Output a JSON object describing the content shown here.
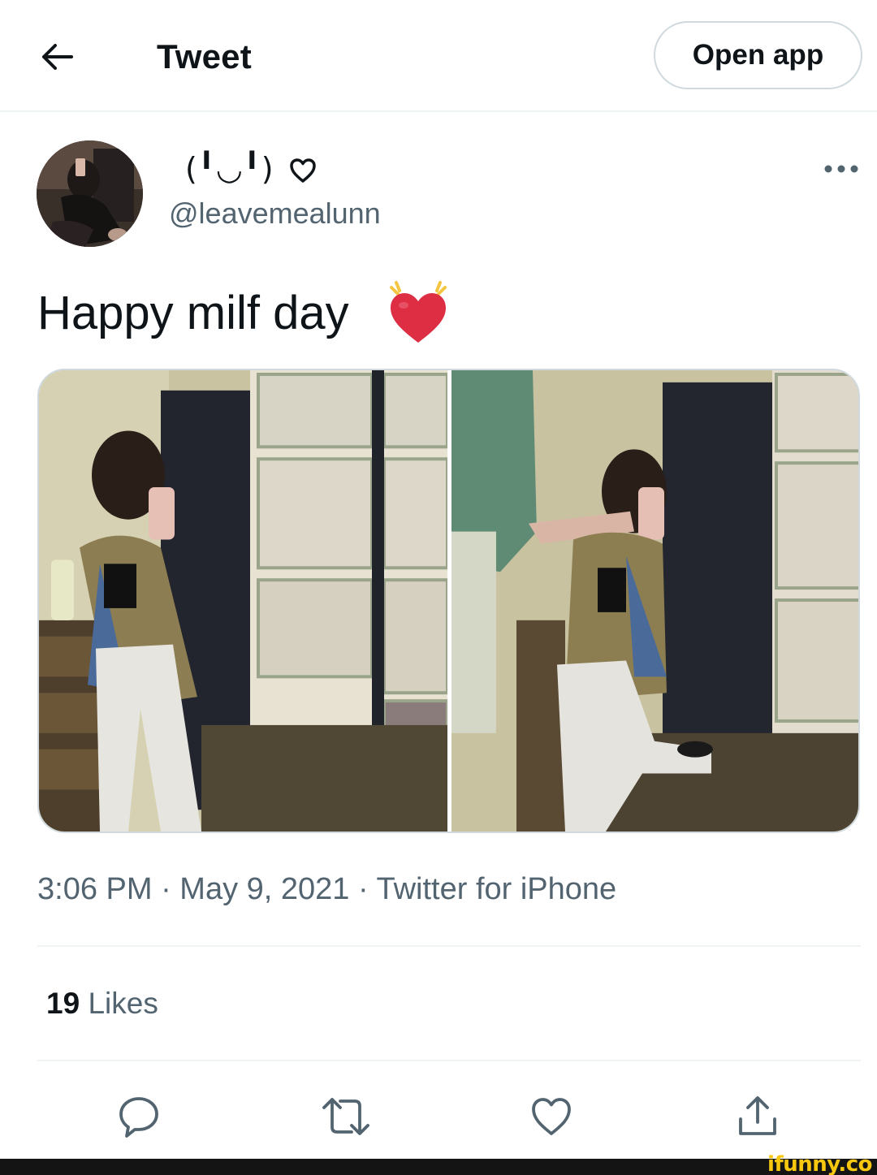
{
  "header": {
    "title": "Tweet",
    "open_app_label": "Open app"
  },
  "author": {
    "display_name": "(╹◡╹)",
    "handle": "@leavemealunn"
  },
  "tweet": {
    "text": "Happy milf day",
    "emoji": "💓"
  },
  "meta": {
    "timestamp": "3:06 PM · May 9, 2021 · Twitter for iPhone"
  },
  "engagement": {
    "likes_count": "19",
    "likes_label": "Likes"
  },
  "icons": {
    "back": "arrow-left-icon",
    "more": "more-horizontal-icon",
    "reply": "reply-icon",
    "retweet": "retweet-icon",
    "like": "heart-icon",
    "share": "share-icon"
  },
  "colors": {
    "text_primary": "#0f1419",
    "text_secondary": "#536471",
    "border": "#cfd9de",
    "divider": "#eff3f4",
    "emoji_heart": "#dd2e44",
    "watermark": "#f7c60f"
  },
  "watermark": "ifunny.co"
}
